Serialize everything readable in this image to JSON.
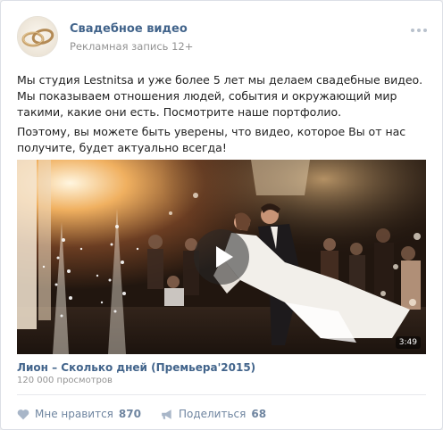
{
  "post": {
    "author_name": "Свадебное видео",
    "subtitle": "Рекламная запись 12+",
    "paragraph1": "Мы студия Lestnitsa и уже более 5 лет мы делаем свадебные видео.  Мы показываем отношения людей, события и окружающий мир такими, какие они есть.  Посмотрите наше портфолио.",
    "paragraph2": "Поэтому, вы можете быть уверены, что видео, которое Вы от нас получите, будет актуально всегда!"
  },
  "video": {
    "title": "Лион – Сколько дней (Премьера'2015)",
    "views": "120 000 просмотров",
    "duration": "3:49"
  },
  "footer": {
    "like_label": "Мне нравится",
    "like_count": "870",
    "share_label": "Поделиться",
    "share_count": "68"
  },
  "colors": {
    "link": "#42648b",
    "muted": "#939393",
    "footer_text": "#6f85a0"
  }
}
